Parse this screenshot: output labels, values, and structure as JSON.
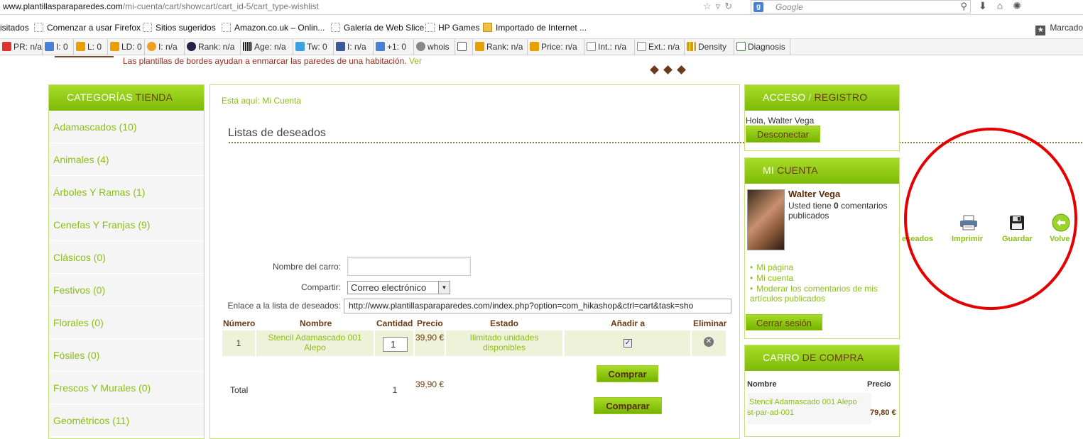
{
  "browser": {
    "url_domain": "www.plantillasparaparedes.com",
    "url_path": "/mi-cuenta/cart/showcart/cart_id-5/cart_type-wishlist",
    "search_placeholder": "Google",
    "bookmarks": [
      "isitados",
      "Comenzar a usar Firefox",
      "Sitios sugeridos",
      "Amazon.co.uk – Onlin...",
      "Galería de Web Slice",
      "HP Games",
      "Importado de Internet ..."
    ],
    "bookmarks_right": "Marcado",
    "seo_items": [
      "PR: n/a",
      "I: 0",
      "L: 0",
      "LD: 0",
      "I: n/a",
      "Rank: n/a",
      "Age: n/a",
      "Tw: 0",
      "I: n/a",
      "+1: 0",
      "whois",
      "",
      "Rank: n/a",
      "Price: n/a",
      "Int.: n/a",
      "Ext.: n/a",
      "Density",
      "Diagnosis"
    ]
  },
  "notice": {
    "text": "Las plantillas de bordes ayudan a enmarcar las paredes de una habitación.",
    "link": "Ver"
  },
  "categories": {
    "title_a": "CATEGORÍAS",
    "title_b": "TIENDA",
    "items": [
      "Adamascados (10)",
      "Animales (4)",
      "Árboles Y Ramas (1)",
      "Cenefas Y Franjas (9)",
      "Clásicos (0)",
      "Festivos (0)",
      "Florales (0)",
      "Fósiles (0)",
      "Frescos Y Murales (0)",
      "Geométricos (11)"
    ]
  },
  "main": {
    "breadcrumb": "Está aquí: Mi Cuenta",
    "heading": "Listas de deseados",
    "cart_name_label": "Nombre del carro:",
    "cart_name_value": "",
    "share_label": "Compartir:",
    "share_value": "Correo electrónico",
    "link_label": "Enlace a la lista de deseados:",
    "link_value": "http://www.plantillasparaparedes.com/index.php?option=com_hikashop&ctrl=cart&task=sho",
    "columns": [
      "Número",
      "Nombre",
      "Cantidad",
      "Precio",
      "Estado",
      "Añadir a",
      "Eliminar"
    ],
    "row": {
      "number": "1",
      "name": "Stencil Adamascado 001 Alepo",
      "qty": "1",
      "price": "39,90 €",
      "status": "Ilimitado unidades disponibles",
      "added": true
    },
    "buy_button": "Comprar",
    "total_label": "Total",
    "total_qty": "1",
    "total_price": "39,90 €",
    "compare_button": "Comparar"
  },
  "access": {
    "title_a": "ACCESO",
    "sep": "/",
    "title_b": "REGISTRO",
    "greeting": "Hola, Walter Vega",
    "logout": "Desconectar"
  },
  "account": {
    "title_a": "MI",
    "title_b": "CUENTA",
    "user_name": "Walter Vega",
    "comments_pre": "Usted tiene",
    "comments_count": "0",
    "comments_post": "comentarios publicados",
    "links": [
      "Mi página",
      "Mi cuenta",
      "Moderar los comentarios de mis artículos publicados"
    ],
    "logout": "Cerrar sesión"
  },
  "cart": {
    "title_a": "CARRO",
    "title_b": "DE COMPRA",
    "col_name": "Nombre",
    "col_price": "Precio",
    "item_name": "Stencil Adamascado 001 Alepo",
    "item_sku": "st-par-ad-001",
    "item_price": "79,80 €"
  },
  "toolbar": {
    "wishlist_partial": "eseados",
    "print": "Imprimir",
    "save": "Guardar",
    "back": "Volve"
  },
  "colors": {
    "accent_green": "#8cbf16",
    "header_brown": "#6a3a10",
    "highlight_red": "#e40000"
  }
}
